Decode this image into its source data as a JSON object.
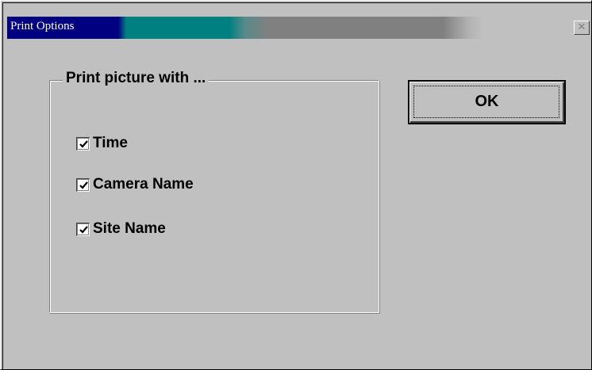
{
  "window": {
    "title": "Print Options",
    "close_glyph": "✕"
  },
  "group": {
    "label": "Print picture with ..."
  },
  "options": [
    {
      "label": "Time",
      "checked": true
    },
    {
      "label": "Camera Name",
      "checked": true
    },
    {
      "label": "Site Name",
      "checked": true
    }
  ],
  "buttons": {
    "ok_label": "OK"
  },
  "colors": {
    "face": "#c0c0c0",
    "title_active": "#000080",
    "title_gradient": "#008080"
  }
}
